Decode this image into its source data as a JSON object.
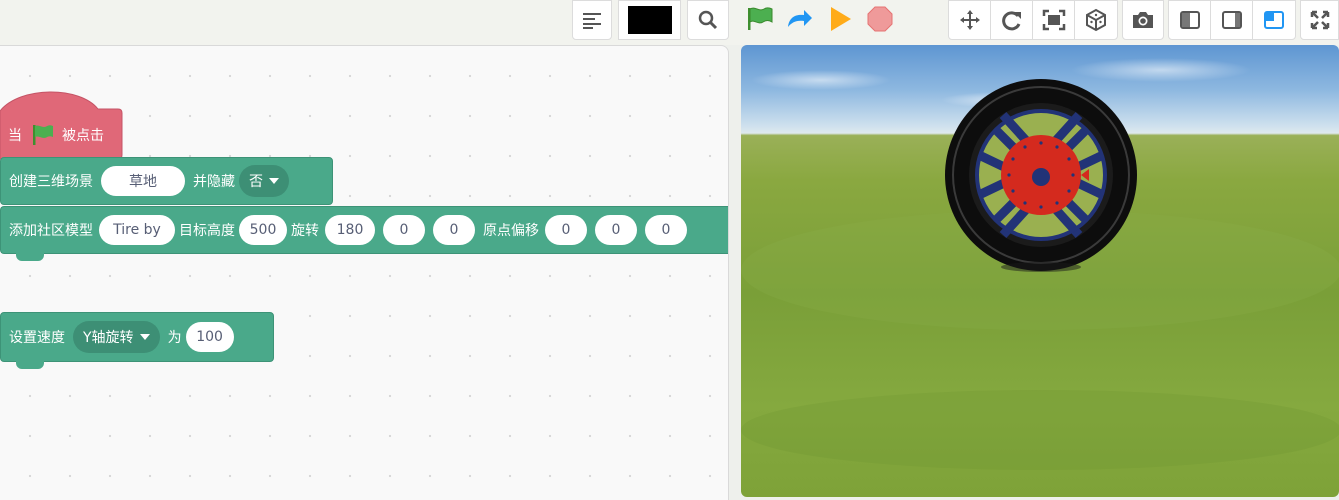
{
  "toolbar": {
    "color_swatch": "#000000",
    "icons": [
      "align-left-icon",
      "color-swatch",
      "search-icon",
      "green-flag-icon",
      "redo-arrow-icon",
      "play-triangle-icon",
      "stop-octagon-icon",
      "move-arrows-icon",
      "rotate-icon",
      "fit-frame-icon",
      "cube-icon",
      "camera-icon",
      "layout-left-icon",
      "layout-right-icon",
      "layout-small-stage-icon",
      "fullscreen-icon"
    ]
  },
  "blocks": {
    "hat": {
      "when": "当",
      "clicked": "被点击",
      "color": "#e06878"
    },
    "create_scene": {
      "label": "创建三维场景",
      "scene": "草地",
      "hide_label": "并隐藏",
      "hide_value": "否"
    },
    "add_model": {
      "label": "添加社区模型",
      "model": "Tire by",
      "height_label": "目标高度",
      "height": "500",
      "rotate_label": "旋转",
      "rot_x": "180",
      "rot_y": "0",
      "rot_z": "0",
      "offset_label": "原点偏移",
      "off_x": "0",
      "off_y": "0",
      "off_z": "0"
    },
    "set_speed": {
      "label": "设置速度",
      "axis": "Y轴旋转",
      "as_label": "为",
      "value": "100"
    }
  },
  "colors": {
    "block_green": "#4aa98a",
    "hat_red": "#e06878",
    "flag_green": "#4caf50",
    "play_orange": "#ffab19",
    "stop_red": "#ef9a9a",
    "active_blue": "#2196f3"
  }
}
